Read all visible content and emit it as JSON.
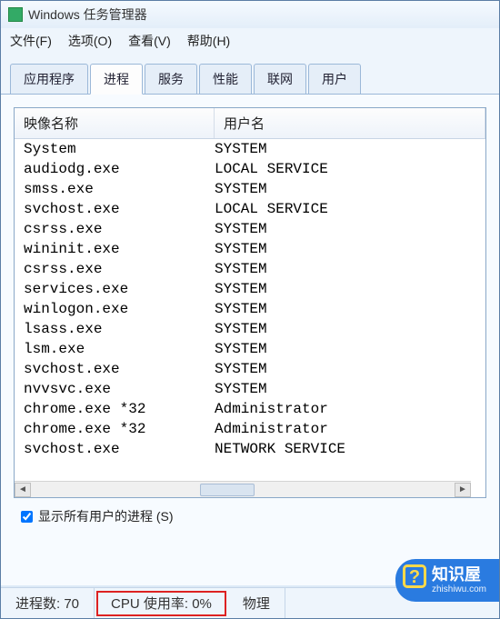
{
  "window": {
    "title": "Windows 任务管理器"
  },
  "menu": {
    "file": "文件(F)",
    "options": "选项(O)",
    "view": "查看(V)",
    "help": "帮助(H)"
  },
  "tabs": {
    "apps": "应用程序",
    "processes": "进程",
    "services": "服务",
    "performance": "性能",
    "networking": "联网",
    "users": "用户"
  },
  "columns": {
    "image_name": "映像名称",
    "user_name": "用户名"
  },
  "processes": [
    {
      "img": "System",
      "user": "SYSTEM"
    },
    {
      "img": "audiodg.exe",
      "user": "LOCAL SERVICE"
    },
    {
      "img": "smss.exe",
      "user": "SYSTEM"
    },
    {
      "img": "svchost.exe",
      "user": "LOCAL SERVICE"
    },
    {
      "img": "csrss.exe",
      "user": "SYSTEM"
    },
    {
      "img": "wininit.exe",
      "user": "SYSTEM"
    },
    {
      "img": "csrss.exe",
      "user": "SYSTEM"
    },
    {
      "img": "services.exe",
      "user": "SYSTEM"
    },
    {
      "img": "winlogon.exe",
      "user": "SYSTEM"
    },
    {
      "img": "lsass.exe",
      "user": "SYSTEM"
    },
    {
      "img": "lsm.exe",
      "user": "SYSTEM"
    },
    {
      "img": "svchost.exe",
      "user": "SYSTEM"
    },
    {
      "img": "nvvsvc.exe",
      "user": "SYSTEM"
    },
    {
      "img": "chrome.exe *32",
      "user": "Administrator"
    },
    {
      "img": "chrome.exe *32",
      "user": "Administrator"
    },
    {
      "img": "svchost.exe",
      "user": "NETWORK SERVICE"
    }
  ],
  "checkbox": {
    "show_all_users": "显示所有用户的进程 (S)",
    "checked": true
  },
  "status": {
    "process_count_label": "进程数: 70",
    "cpu_usage_label": "CPU 使用率: 0%",
    "phys_mem_label": "物理"
  },
  "watermark": {
    "title": "知识屋",
    "url": "zhishiwu.com"
  }
}
